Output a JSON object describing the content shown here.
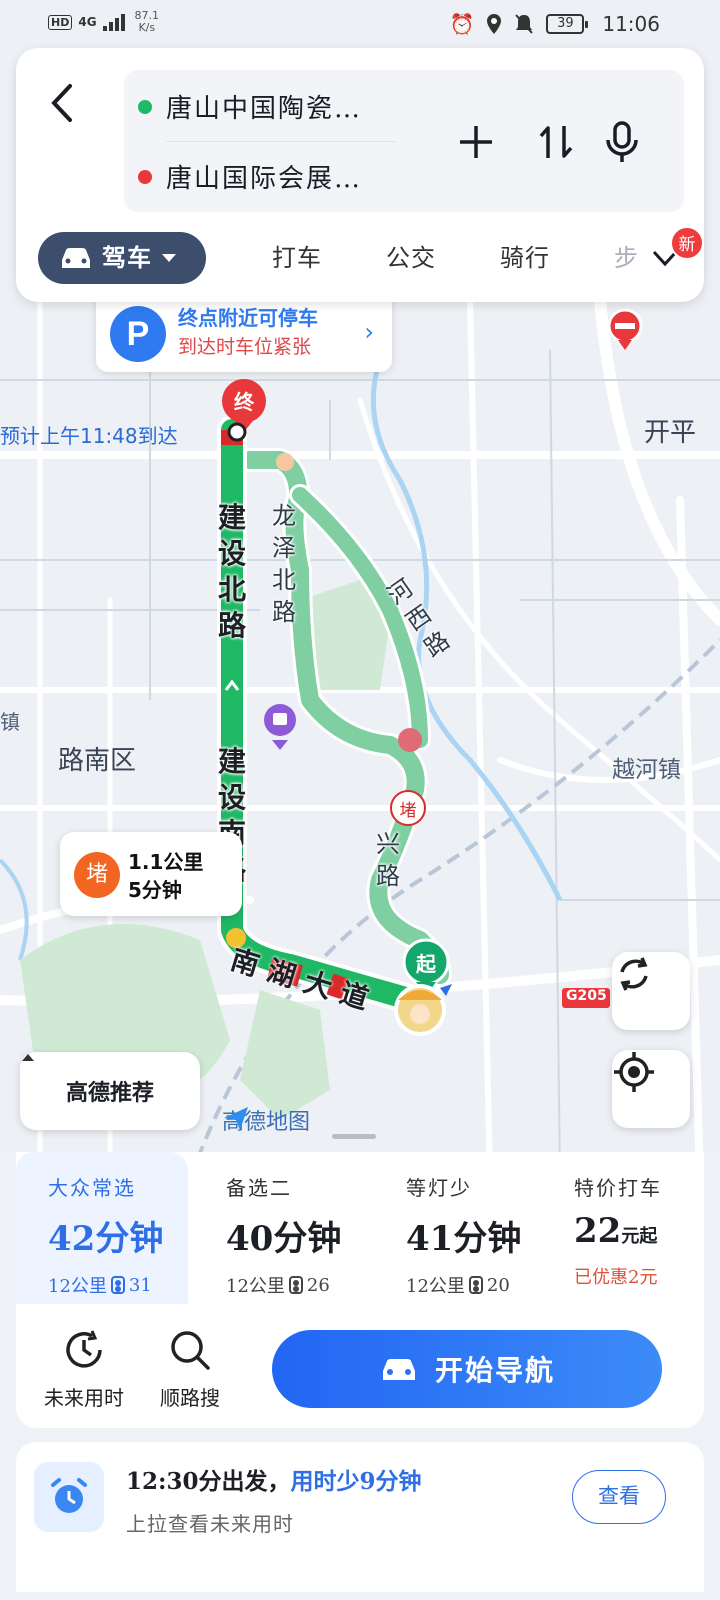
{
  "status_bar": {
    "hd": "HD",
    "signal": "4G",
    "net_speed": "87.1",
    "net_unit": "K/s",
    "battery": "39",
    "time": "11:06"
  },
  "route": {
    "origin": "唐山中国陶瓷…",
    "destination": "唐山国际会展…",
    "origin_color": "#1fb864",
    "destination_color": "#e8383b"
  },
  "modes": {
    "drive": "驾车",
    "taxi": "打车",
    "transit": "公交",
    "bike": "骑行",
    "walk_partial": "步",
    "new_badge": "新"
  },
  "parking": {
    "icon": "P",
    "title": "终点附近可停车",
    "subtitle": "到达时车位紧张"
  },
  "map": {
    "eta": "预计上午11:48到达",
    "end_marker": "终",
    "start_marker": "起",
    "jam_marker": "堵",
    "labels": {
      "kaiping": "开平",
      "lunan": "路南区",
      "yuehe": "越河镇",
      "g205": "G205",
      "edge": "镇"
    },
    "roads": {
      "jianshe_north": "建设北路",
      "jianshe_south": "建设南路",
      "longze_north": "龙泽北路",
      "hexi": "河西路",
      "nanhu": "南湖大道",
      "partial": "兴路"
    },
    "jam": {
      "icon": "堵",
      "distance": "1.1公里",
      "time": "5分钟"
    },
    "recommend": "高德推荐",
    "logo": "高德地图",
    "colors": {
      "smooth": "#1fb864",
      "alt_route": "#7fcfa3",
      "jam": "#d92a2a"
    }
  },
  "options": [
    {
      "label": "大众常选",
      "time": "42分钟",
      "distance": "12公里",
      "lights": "31",
      "selected": true
    },
    {
      "label": "备选二",
      "time": "40分钟",
      "distance": "12公里",
      "lights": "26",
      "selected": false
    },
    {
      "label": "等灯少",
      "time": "41分钟",
      "distance": "12公里",
      "lights": "20",
      "selected": false
    },
    {
      "label": "特价打车",
      "price": "22",
      "price_unit": "元起",
      "discount": "已优惠2元",
      "selected": false
    }
  ],
  "tools": {
    "future_time": "未来用时",
    "along_search": "顺路搜",
    "start_navigation": "开始导航"
  },
  "future": {
    "title_a": "12:30分出发，",
    "title_b": "用时少9分钟",
    "subtitle": "上拉查看未来用时",
    "button": "查看"
  }
}
